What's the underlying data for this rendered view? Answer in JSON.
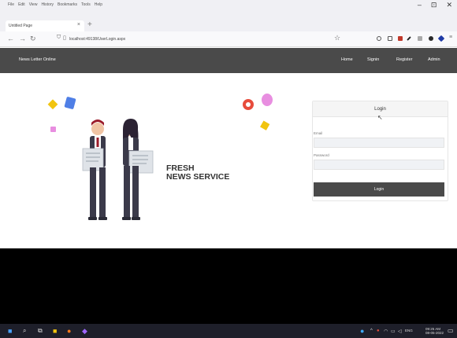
{
  "browser": {
    "menu": [
      "File",
      "Edit",
      "View",
      "History",
      "Bookmarks",
      "Tools",
      "Help"
    ],
    "tab_title": "Untitled Page",
    "tab_close": "×",
    "new_tab": "+",
    "url": "localhost:49138/UserLogin.aspx",
    "window_controls": [
      "–",
      "⊡",
      "✕"
    ]
  },
  "site": {
    "brand": "News Letter Online",
    "nav": [
      "Home",
      "Signin",
      "Register",
      "Admin"
    ]
  },
  "hero": {
    "title_line1": "FRESH",
    "title_line2": "NEWS SERVICE"
  },
  "login": {
    "header": "Login",
    "email_label": "Email",
    "password_label": "Password",
    "button": "Login"
  },
  "taskbar": {
    "lang": "ENG",
    "time": "09:25 AM",
    "date": "08-05-2022"
  },
  "colors": {
    "header_bg": "#4a4a4a",
    "illus_blue": "#4f7fe6",
    "illus_yellow": "#f1c40f",
    "illus_pink": "#e88ee0",
    "illus_red": "#e74c3c"
  }
}
